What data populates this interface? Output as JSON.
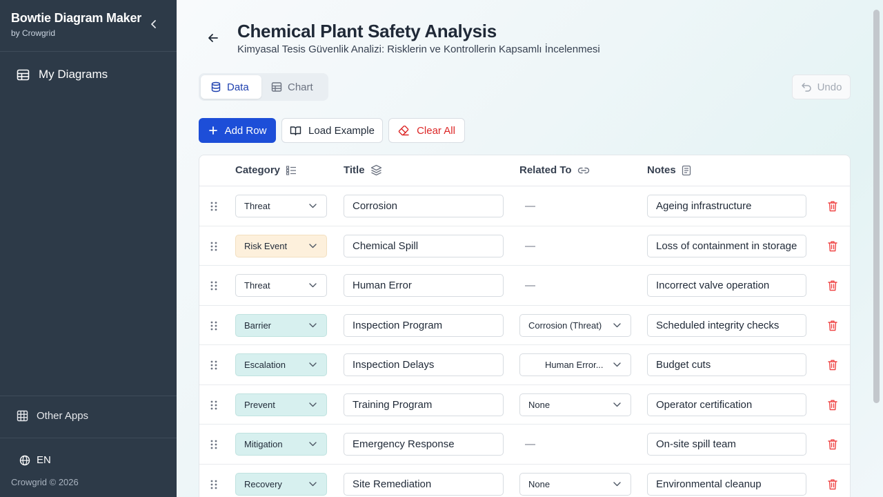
{
  "sidebar": {
    "app_title": "Bowtie Diagram Maker",
    "app_subtitle": "by Crowgrid",
    "nav_items": [
      {
        "label": "My Diagrams",
        "icon": "table-icon"
      }
    ],
    "other_apps": "Other Apps",
    "language": "EN",
    "copyright": "Crowgrid © 2026"
  },
  "header": {
    "title": "Chemical Plant Safety Analysis",
    "subtitle": "Kimyasal Tesis Güvenlik Analizi: Risklerin ve Kontrollerin Kapsamlı İncelenmesi"
  },
  "view_tabs": [
    {
      "label": "Data",
      "active": true
    },
    {
      "label": "Chart",
      "active": false
    }
  ],
  "toolbar": {
    "undo": "Undo",
    "add_row": "Add Row",
    "load_example": "Load Example",
    "clear_all": "Clear All"
  },
  "table": {
    "columns": [
      "Category",
      "Title",
      "Related To",
      "Notes"
    ],
    "empty_marker": "—",
    "rows": [
      {
        "category": "Threat",
        "title": "Corrosion",
        "related": "",
        "notes": "Ageing infrastructure"
      },
      {
        "category": "Risk Event",
        "title": "Chemical Spill",
        "related": "",
        "notes": "Loss of containment in storage"
      },
      {
        "category": "Threat",
        "title": "Human Error",
        "related": "",
        "notes": "Incorrect valve operation"
      },
      {
        "category": "Barrier",
        "title": "Inspection Program",
        "related": "Corrosion (Threat)",
        "notes": "Scheduled integrity checks"
      },
      {
        "category": "Escalation",
        "title": "Inspection Delays",
        "related": "Human Error...",
        "notes": "Budget cuts"
      },
      {
        "category": "Prevent",
        "title": "Training Program",
        "related": "None",
        "notes": "Operator certification"
      },
      {
        "category": "Mitigation",
        "title": "Emergency Response",
        "related": "",
        "notes": "On-site spill team"
      },
      {
        "category": "Recovery",
        "title": "Site Remediation",
        "related": "None",
        "notes": "Environmental cleanup"
      }
    ]
  },
  "colors": {
    "sidebar_bg": "#2d3a48",
    "primary": "#1d4ed8",
    "danger": "#dc2626",
    "risk_event_bg": "#fdf0dc",
    "control_bg": "#d7f0ef"
  }
}
